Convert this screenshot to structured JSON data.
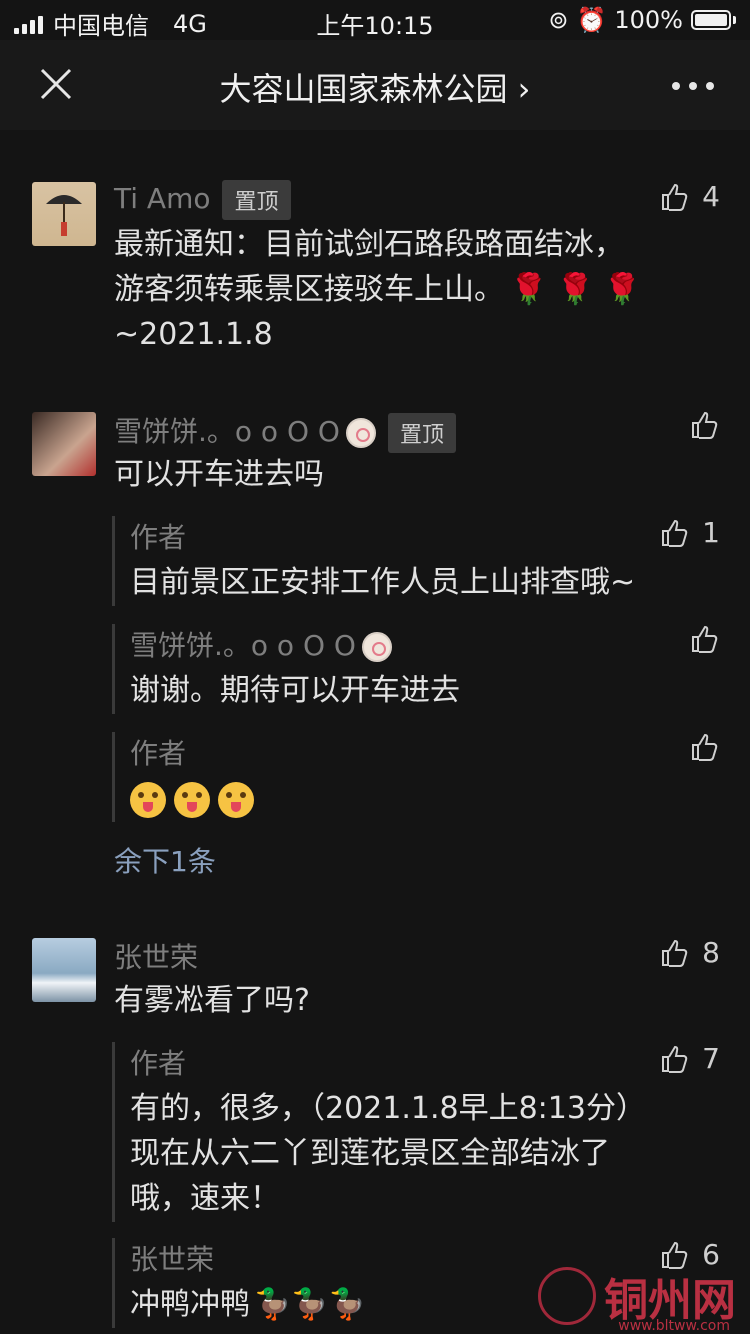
{
  "status_bar": {
    "carrier": "中国电信",
    "network": "4G",
    "time": "上午10:15",
    "battery": "100%"
  },
  "nav": {
    "title": "大容山国家森林公园 ›"
  },
  "comments": [
    {
      "name": "Ti Amo",
      "pinned": "置顶",
      "text_line1": "最新通知：目前试剑石路段路面结冰，",
      "text_line2": "游客须转乘景区接驳车上山。",
      "text_line3": "~2021.1.8",
      "likes": "4"
    },
    {
      "name": "雪饼饼.。o o O O",
      "pinned": "置顶",
      "text": "可以开车进去吗",
      "replies": [
        {
          "name": "作者",
          "text": "目前景区正安排工作人员上山排查哦~",
          "likes": "1"
        },
        {
          "name": "雪饼饼.。o o O O",
          "text": "谢谢。期待可以开车进去",
          "likes": ""
        },
        {
          "name": "作者",
          "text": "",
          "likes": ""
        }
      ],
      "more": "余下1条"
    },
    {
      "name": "张世荣",
      "text": "有雾凇看了吗?",
      "likes": "8",
      "replies": [
        {
          "name": "作者",
          "text_line1": "有的，很多，（2021.1.8早上8:13分）",
          "text_line2": "现在从六二丫到莲花景区全部结冰了",
          "text_line3": "哦，速来！",
          "likes": "7"
        },
        {
          "name": "张世荣",
          "text": "冲鸭冲鸭",
          "likes": "6"
        }
      ]
    }
  ],
  "watermark": {
    "brand": "铜州网",
    "url": "www.bltww.com"
  },
  "icons": {
    "close": "close-icon",
    "more": "more-icon",
    "like": "thumbs-up-icon"
  }
}
